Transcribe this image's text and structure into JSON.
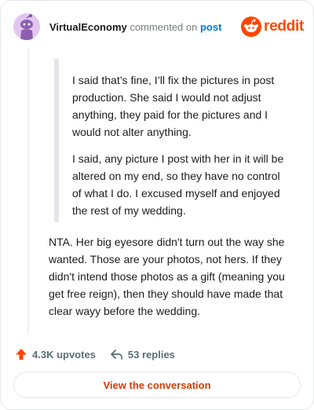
{
  "header": {
    "username": "VirtualEconomy",
    "action_text": "commented on",
    "post_link": "post",
    "logo_text": "reddit"
  },
  "comment": {
    "quote_paragraphs": [
      "I said that’s fine, I’ll fix the pictures in post production. She said I would not adjust anything, they paid for the pictures and I would not alter anything.",
      "I said, any picture I post with her in it will be altered on my end, so they have no control of what I do. I excused myself and enjoyed the rest of my wedding."
    ],
    "body": "NTA. Her big eyesore didn't turn out the way she wanted. Those are your photos, not hers. If they didn't intend those photos as a gift (meaning you get free reign), then they should have made that clear wayy before the wedding."
  },
  "actions": {
    "upvotes": "4.3K upvotes",
    "replies": "53 replies"
  },
  "cta_label": "View the conversation",
  "colors": {
    "brand": "#ff4500",
    "link": "#0079d3",
    "upvote": "#ff4500",
    "cta_text": "#d93a00"
  }
}
